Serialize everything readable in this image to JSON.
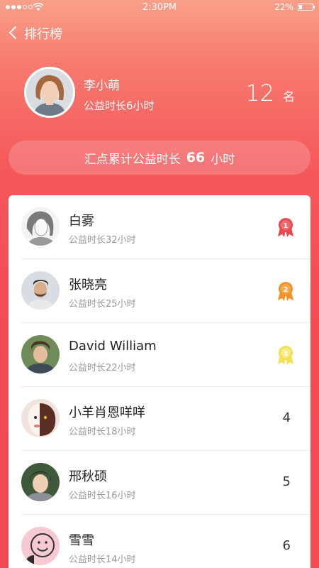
{
  "status_bar": {
    "time": "2:30PM",
    "battery": "22%"
  },
  "nav": {
    "title": "排行榜"
  },
  "me": {
    "name": "李小萌",
    "hours": "公益时长6小时",
    "rank": "12",
    "rank_unit": "名"
  },
  "summary": {
    "prefix": "汇点累计公益时长",
    "value": "66",
    "suffix": "小时"
  },
  "colors": {
    "gold": "#f7c51a",
    "silver": "#f29327",
    "bronze": "#f2e057",
    "medal_red": "#e8484e"
  },
  "list": [
    {
      "name": "白雾",
      "hours": "公益时长32小时",
      "rank": "1",
      "medal": "gold-medal-icon"
    },
    {
      "name": "张晓亮",
      "hours": "公益时长25小时",
      "rank": "2",
      "medal": "silver-medal-icon"
    },
    {
      "name": "David William",
      "hours": "公益时长22小时",
      "rank": "3",
      "medal": "bronze-medal-icon"
    },
    {
      "name": "小羊肖恩咩咩",
      "hours": "公益时长18小时",
      "rank": "4"
    },
    {
      "name": "邢秋硕",
      "hours": "公益时长16小时",
      "rank": "5"
    },
    {
      "name": "雪雪",
      "hours": "公益时长14小时",
      "rank": "6"
    }
  ]
}
